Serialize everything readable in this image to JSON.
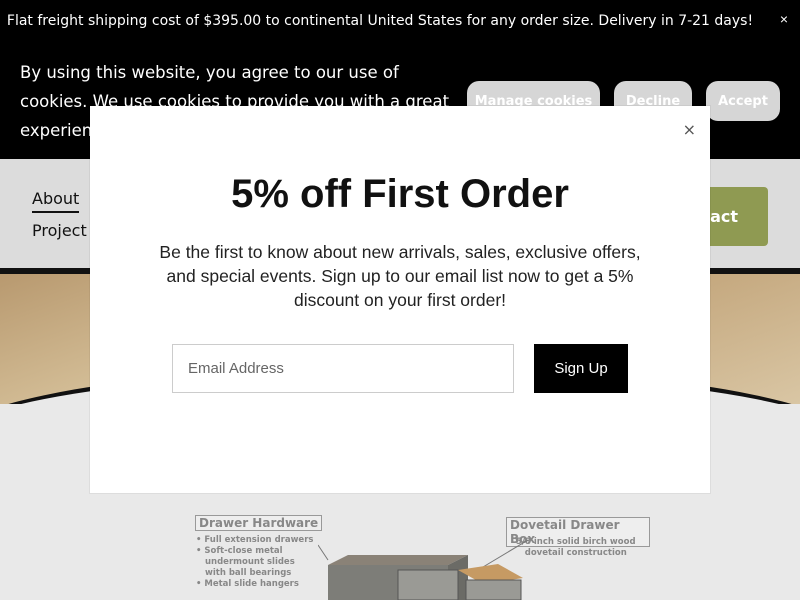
{
  "announcement": {
    "text": "Flat freight shipping cost of $395.00 to continental United States for any order size.  Delivery in 7-21 days!",
    "close": "×"
  },
  "cookie_banner": {
    "text": "By using this website, you agree to our use of cookies. We use cookies to provide you with a great experience",
    "manage_label": "Manage cookies",
    "decline_label": "Decline",
    "accept_label": "Accept"
  },
  "nav": {
    "about": "About",
    "projects": "Project",
    "contact": "tact"
  },
  "diagram": {
    "left_title": "Drawer Hardware",
    "left_notes": [
      "• Full extension drawers",
      "• Soft-close metal",
      "  undermount slides",
      "  with ball bearings",
      "• Metal slide hangers"
    ],
    "right_title": "Dovetail Drawer Box",
    "right_notes": [
      "5/8 inch solid birch wood",
      "dovetail construction"
    ]
  },
  "modal": {
    "close": "×",
    "title": "5% off First Order",
    "description": "Be the first to know about new arrivals, sales, exclusive offers, and special events. Sign up to our email list now to get a 5% discount on your first order!",
    "email_placeholder": "Email Address",
    "signup_label": "Sign Up"
  },
  "colors": {
    "contact_button": "#8f9a52",
    "cookie_button": "#d6d6d6"
  }
}
